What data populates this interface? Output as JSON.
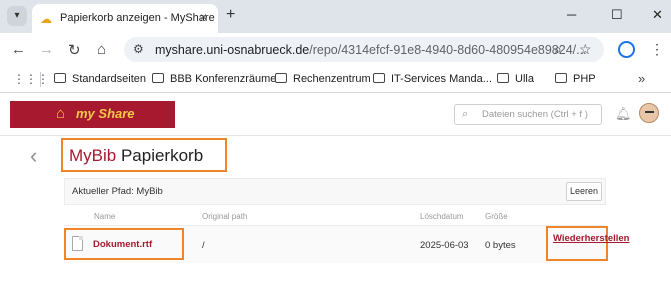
{
  "browser": {
    "tab_title": "Papierkorb anzeigen - MyShare",
    "tab_close": "×",
    "new_tab": "+",
    "url_host": "myshare.uni-osnabrueck.de",
    "url_path": "/repo/4314efcf-91e8-4940-8d60-480954e89824/...",
    "bookmarks": [
      "Standardseiten",
      "BBB Konferenzräume",
      "Rechenzentrum",
      "IT-Services Manda...",
      "Ulla",
      "PHP"
    ],
    "bookmarks_more": "»"
  },
  "app": {
    "logo_text": "my Share",
    "search_placeholder": "Dateien suchen (Ctrl + f )"
  },
  "page": {
    "title_brand": "MyBib",
    "title_rest": " Papierkorb",
    "path_label": "Aktueller Pfad: MyBib",
    "clear_button": "Leeren"
  },
  "table": {
    "columns": [
      "Name",
      "Original path",
      "Löschdatum",
      "Größe"
    ],
    "rows": [
      {
        "name": "Dokument.rtf",
        "original_path": "/",
        "deleted": "2025-06-03",
        "size": "0 bytes",
        "action": "Wiederherstellen"
      }
    ]
  },
  "colors": {
    "brand": "#a6192e",
    "highlight": "#ef8528"
  }
}
